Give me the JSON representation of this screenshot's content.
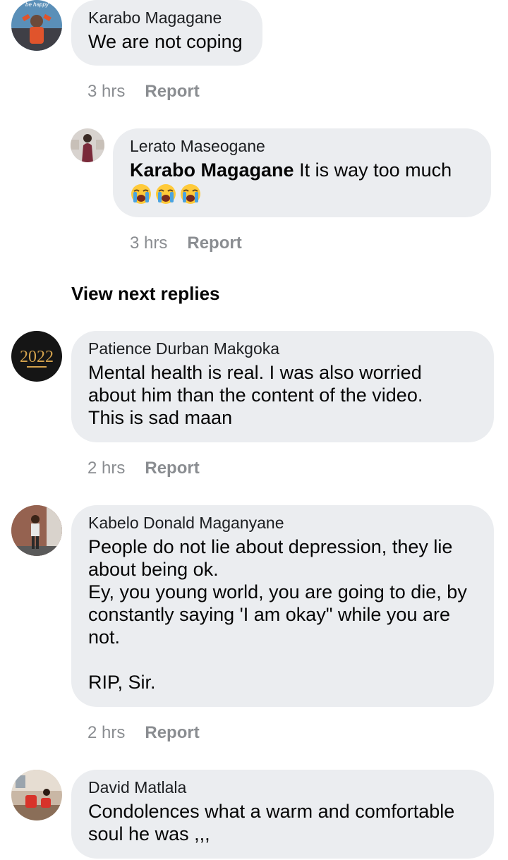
{
  "comments": [
    {
      "author": "Karabo Magagane",
      "text": "We are not coping",
      "time": "3 hrs",
      "report": "Report",
      "avatar_bg": "#5a8fb8",
      "avatar_accent": "#e0542c",
      "avatar_caption": "be happy"
    },
    {
      "author": "Lerato Maseogane",
      "mention": "Karabo Magagane",
      "text": "It is way too much",
      "emoji_icons": [
        "loudly-crying-face-icon",
        "loudly-crying-face-icon",
        "loudly-crying-face-icon"
      ],
      "time": "3 hrs",
      "report": "Report",
      "avatar_bg": "#d8d3cf",
      "avatar_accent": "#7a2a3a"
    },
    {
      "author": "Patience Durban Makgoka",
      "text": "Mental health is real. I was also worried\nabout him than the content of the video.\nThis is sad maan",
      "time": "2 hrs",
      "report": "Report",
      "avatar_bg": "#151515",
      "avatar_accent": "#d4a24c",
      "avatar_text": "2022"
    },
    {
      "author": "Kabelo Donald Maganyane",
      "text": "People do not lie about depression, they lie\nabout being ok.\nEy, you young world, you are going to die, by\nconstantly saying 'I am okay\" while you are\nnot.\n\nRIP, Sir.",
      "time": "2 hrs",
      "report": "Report",
      "avatar_bg": "#8a5a4a",
      "avatar_accent": "#e8e8e8"
    },
    {
      "author": "David Matlala",
      "text": "Condolences what a warm and comfortable\nsoul he was ,,,",
      "avatar_bg": "#c9b7a5",
      "avatar_accent": "#d8332a"
    }
  ],
  "view_next_replies": "View next replies",
  "colors": {
    "bubble": "#ebedf0",
    "meta": "#8a8d91",
    "text": "#050505"
  }
}
